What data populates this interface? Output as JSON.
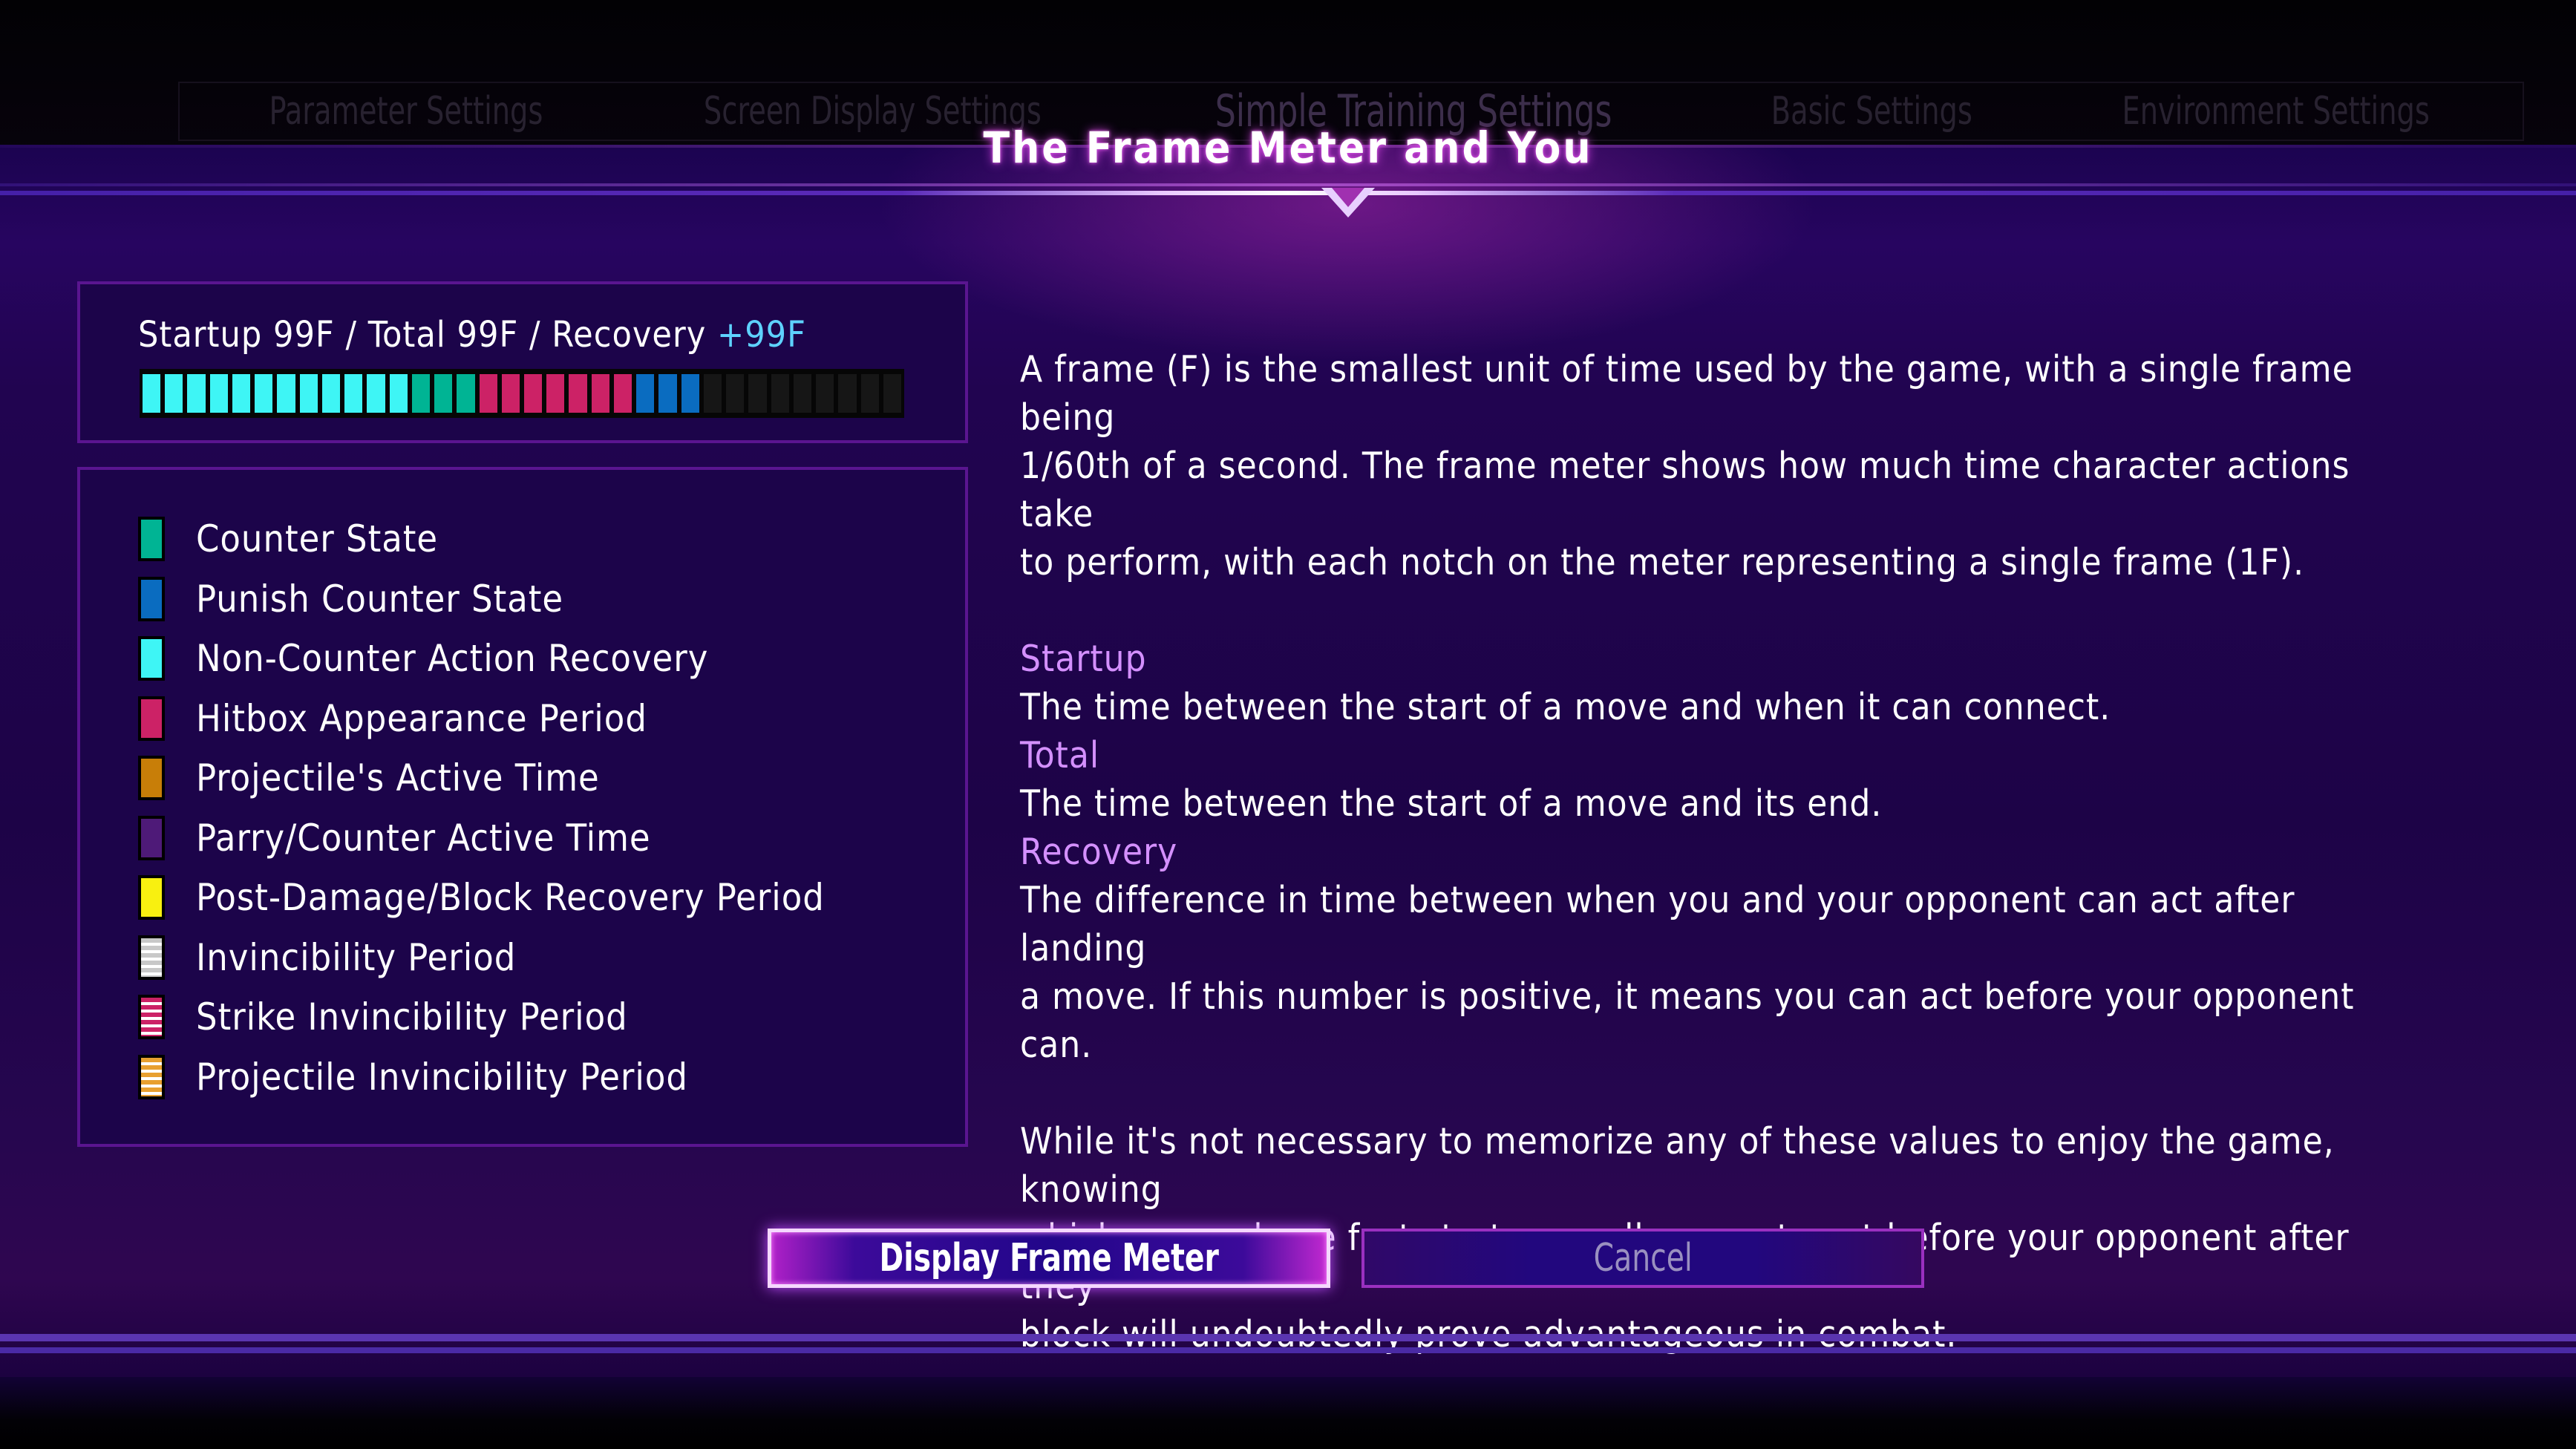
{
  "background_tabs": [
    {
      "label": "Parameter Settings",
      "active": false
    },
    {
      "label": "Screen Display Settings",
      "active": false
    },
    {
      "label": "Simple Training Settings",
      "active": true
    },
    {
      "label": "Basic Settings",
      "active": false
    },
    {
      "label": "Environment Settings",
      "active": false
    }
  ],
  "dialog": {
    "title": "The Frame Meter and You"
  },
  "meter": {
    "readout": {
      "startup_label": "Startup",
      "startup_value": "99F",
      "total_label": "Total",
      "total_value": "99F",
      "recovery_label": "Recovery",
      "recovery_value": "+99F",
      "separator": "/"
    },
    "segments": [
      {
        "type": "Non-Counter Action Recovery",
        "count": 12,
        "color": "#3ef5f5"
      },
      {
        "type": "Counter State",
        "count": 3,
        "color": "#00b494"
      },
      {
        "type": "Hitbox Appearance Period",
        "count": 7,
        "color": "#cc2266"
      },
      {
        "type": "Punish Counter State",
        "count": 3,
        "color": "#0a6cc0"
      },
      {
        "type": "Empty",
        "count": 9,
        "color": "#161616"
      }
    ]
  },
  "legend": [
    {
      "label": "Counter State",
      "color": "#00b494",
      "pattern": "solid"
    },
    {
      "label": "Punish Counter State",
      "color": "#0a6cc0",
      "pattern": "solid"
    },
    {
      "label": "Non-Counter Action Recovery",
      "color": "#3ef5f5",
      "pattern": "solid"
    },
    {
      "label": "Hitbox Appearance Period",
      "color": "#cc2266",
      "pattern": "solid"
    },
    {
      "label": "Projectile's Active Time",
      "color": "#c87e08",
      "pattern": "solid"
    },
    {
      "label": "Parry/Counter Active Time",
      "color": "#4e1a78",
      "pattern": "solid"
    },
    {
      "label": "Post-Damage/Block Recovery Period",
      "color": "#f8f010",
      "pattern": "solid"
    },
    {
      "label": "Invincibility Period",
      "color": "#c8c8c8",
      "pattern": "striped"
    },
    {
      "label": "Strike Invincibility Period",
      "color": "#cc2266",
      "pattern": "striped"
    },
    {
      "label": "Projectile Invincibility Period",
      "color": "#e8a030",
      "pattern": "striped"
    }
  ],
  "explanation": {
    "intro": [
      "A frame (F) is the smallest unit of time used by the game, with a single frame being",
      "1/60th of a second. The frame meter shows how much time character actions take",
      "to perform, with each notch on the meter representing a single frame (1F)."
    ],
    "terms": [
      {
        "heading": "Startup",
        "lines": [
          "The time between the start of a move and when it can connect."
        ]
      },
      {
        "heading": "Total",
        "lines": [
          "The time between the start of a move and its end."
        ]
      },
      {
        "heading": "Recovery",
        "lines": [
          "The difference in time between when you and your opponent can act after landing",
          "a move. If this number is positive, it means you can act before your opponent can."
        ]
      }
    ],
    "closing": [
      "While it's not necessary to memorize any of these values to enjoy the game, knowing",
      "which moves have fast startup or allow you to act before your opponent after they",
      "block will undoubtedly prove advantageous in combat."
    ]
  },
  "buttons": {
    "confirm": "Display Frame Meter",
    "cancel": "Cancel"
  },
  "colors": {
    "heading_accent": "#d490ff",
    "recovery_value": "#5ed2ff",
    "panel_border": "#5a1590"
  }
}
